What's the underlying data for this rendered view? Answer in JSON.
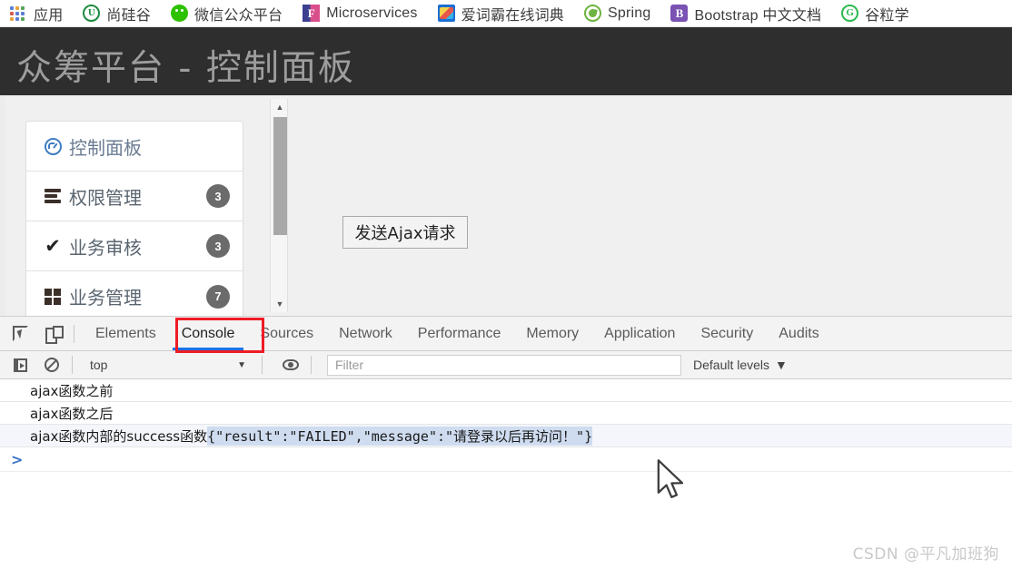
{
  "bookmarks": [
    {
      "icon": "apps-grid-icon",
      "label": "应用"
    },
    {
      "icon": "shangguigu-icon",
      "label": "尚硅谷"
    },
    {
      "icon": "wechat-icon",
      "label": "微信公众平台"
    },
    {
      "icon": "microservices-icon",
      "label": "Microservices"
    },
    {
      "icon": "iciba-dictionary-icon",
      "label": "爱词霸在线词典"
    },
    {
      "icon": "spring-leaf-icon",
      "label": "Spring"
    },
    {
      "icon": "bootstrap-icon",
      "label": "Bootstrap 中文文档"
    },
    {
      "icon": "guli-icon",
      "label": "谷粒学"
    }
  ],
  "page": {
    "header_title": "众筹平台 - 控制面板",
    "header_bg": "#2e2e2e",
    "header_text_color": "#9d9d9d",
    "ajax_button_label": "发送Ajax请求",
    "sidebar": {
      "items": [
        {
          "icon": "dashboard-clock-icon",
          "label": "控制面板",
          "badge": "",
          "active": true
        },
        {
          "icon": "server-stack-icon",
          "label": "权限管理",
          "badge": "3",
          "active": false
        },
        {
          "icon": "check-mark-icon",
          "label": "业务审核",
          "badge": "3",
          "active": false
        },
        {
          "icon": "grid-squares-icon",
          "label": "业务管理",
          "badge": "7",
          "active": false
        }
      ]
    }
  },
  "devtools": {
    "tabs": [
      {
        "label": "Elements",
        "active": false
      },
      {
        "label": "Console",
        "active": true
      },
      {
        "label": "Sources",
        "active": false
      },
      {
        "label": "Network",
        "active": false
      },
      {
        "label": "Performance",
        "active": false
      },
      {
        "label": "Memory",
        "active": false
      },
      {
        "label": "Application",
        "active": false
      },
      {
        "label": "Security",
        "active": false
      },
      {
        "label": "Audits",
        "active": false
      }
    ],
    "active_tab_underline_color": "#1a73e8",
    "highlight_box_color": "#ee1c24",
    "toolbar": {
      "inspect_icon": "inspect-element-icon",
      "device_icon": "device-toolbar-icon"
    },
    "filterbar": {
      "sidebar_toggle_icon": "console-sidebar-icon",
      "clear_icon": "clear-console-icon",
      "context_value": "top",
      "context_caret": "▼",
      "eye_icon": "live-expression-eye-icon",
      "filter_placeholder": "Filter",
      "filter_value": "",
      "levels_label": "Default levels",
      "levels_caret": "▼"
    },
    "console_messages": [
      {
        "text": "ajax函数之前",
        "striped": false,
        "selection": ""
      },
      {
        "text": "ajax函数之后",
        "striped": false,
        "selection": ""
      },
      {
        "text": "ajax函数内部的success函数",
        "striped": true,
        "selection": "{\"result\":\"FAILED\",\"message\":\"请登录以后再访问！\"}"
      }
    ],
    "prompt_caret": ">",
    "selection_highlight_color": "#cfdcf0"
  },
  "watermark": "CSDN @平凡加班狗"
}
